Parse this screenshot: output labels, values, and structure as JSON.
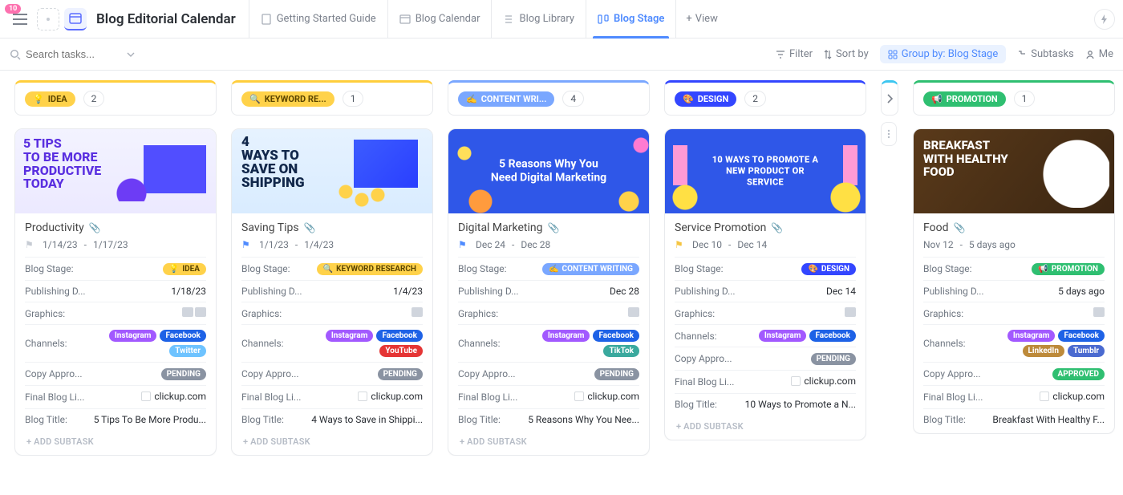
{
  "topbar": {
    "notification_count": "10",
    "project_title": "Blog Editorial Calendar",
    "views": [
      {
        "label": "Getting Started Guide",
        "active": false
      },
      {
        "label": "Blog Calendar",
        "active": false
      },
      {
        "label": "Blog Library",
        "active": false
      },
      {
        "label": "Blog Stage",
        "active": true
      }
    ],
    "add_view_label": "View"
  },
  "toolbar": {
    "search_placeholder": "Search tasks...",
    "filter_label": "Filter",
    "sort_label": "Sort by",
    "group_prefix": "Group by:",
    "group_value": "Blog Stage",
    "subtasks_label": "Subtasks",
    "me_label": "Me"
  },
  "add_subtask_label": "+ ADD SUBTASK",
  "fields": {
    "blog_stage": "Blog Stage:",
    "publishing_date": "Publishing D...",
    "graphics": "Graphics:",
    "channels": "Channels:",
    "copy_approval": "Copy Appro...",
    "final_link": "Final Blog Li...",
    "blog_title": "Blog Title:"
  },
  "columns": [
    {
      "id": "idea",
      "accent": "#ffce3d",
      "chip_label": "IDEA",
      "chip_class": "bg-idea",
      "chip_icon": "💡",
      "count": "2"
    },
    {
      "id": "keyword",
      "accent": "#ffce3d",
      "chip_label": "KEYWORD RE...",
      "chip_class": "bg-keyword",
      "chip_icon": "🔍",
      "count": "1"
    },
    {
      "id": "content",
      "accent": "#7aa7ff",
      "chip_label": "CONTENT WRI...",
      "chip_class": "bg-content",
      "chip_icon": "✍️",
      "count": "4"
    },
    {
      "id": "design",
      "accent": "#3346ff",
      "chip_label": "DESIGN",
      "chip_class": "bg-design",
      "chip_icon": "🎨",
      "count": "2"
    },
    {
      "id": "promo",
      "accent": "#2fbf71",
      "chip_label": "PROMOTION",
      "chip_class": "bg-promo",
      "chip_icon": "📢",
      "count": "1"
    }
  ],
  "cards": {
    "idea": {
      "title": "Productivity",
      "date_start": "1/14/23",
      "date_end": "1/17/23",
      "flag": "flag-grey",
      "stage_label": "IDEA",
      "stage_icon": "💡",
      "stage_class": "bg-idea",
      "publishing_date": "1/18/23",
      "channels": [
        "Instagram",
        "Facebook",
        "Twitter"
      ],
      "channel_classes": [
        "c-instagram",
        "c-facebook",
        "c-twitter"
      ],
      "copy_approval": "PENDING",
      "copy_class": "c-pending",
      "final_link": "clickup.com",
      "blog_title": "5 Tips To Be More Produ..."
    },
    "keyword": {
      "title": "Saving Tips",
      "date_start": "1/1/23",
      "date_end": "1/4/23",
      "flag": "flag-blue",
      "stage_label": "KEYWORD RESEARCH",
      "stage_icon": "🔍",
      "stage_class": "bg-keyword",
      "publishing_date": "1/4/23",
      "channels": [
        "Instagram",
        "Facebook",
        "YouTube"
      ],
      "channel_classes": [
        "c-instagram",
        "c-facebook",
        "c-youtube"
      ],
      "copy_approval": "PENDING",
      "copy_class": "c-pending",
      "final_link": "clickup.com",
      "blog_title": "4 Ways to Save in Shippi..."
    },
    "content": {
      "title": "Digital Marketing",
      "date_start": "Dec 24",
      "date_end": "Dec 28",
      "flag": "flag-blue",
      "stage_label": "CONTENT WRITING",
      "stage_icon": "✍️",
      "stage_class": "bg-content",
      "publishing_date": "Dec 28",
      "channels": [
        "Instagram",
        "Facebook",
        "TikTok"
      ],
      "channel_classes": [
        "c-instagram",
        "c-facebook",
        "c-tiktok"
      ],
      "copy_approval": "PENDING",
      "copy_class": "c-pending",
      "final_link": "clickup.com",
      "blog_title": "5 Reasons Why You Nee..."
    },
    "design": {
      "title": "Service Promotion",
      "date_start": "Dec 10",
      "date_end": "Dec 14",
      "flag": "flag-yellow",
      "stage_label": "DESIGN",
      "stage_icon": "🎨",
      "stage_class": "bg-design",
      "publishing_date": "Dec 14",
      "channels": [
        "Instagram",
        "Facebook"
      ],
      "channel_classes": [
        "c-instagram",
        "c-facebook"
      ],
      "copy_approval": "PENDING",
      "copy_class": "c-pending",
      "final_link": "clickup.com",
      "blog_title": "10 Ways to Promote a N..."
    },
    "promo": {
      "title": "Food",
      "date_start": "Nov 12",
      "date_end": "5 days ago",
      "flag": "",
      "stage_label": "PROMOTION",
      "stage_icon": "📢",
      "stage_class": "bg-promo",
      "publishing_date": "5 days ago",
      "channels": [
        "Instagram",
        "Facebook",
        "LinkedIn",
        "Tumblr"
      ],
      "channel_classes": [
        "c-instagram",
        "c-facebook",
        "c-linkedin",
        "c-tumblr"
      ],
      "copy_approval": "APPROVED",
      "copy_class": "c-approved",
      "final_link": "clickup.com",
      "blog_title": "Breakfast With Healthy F..."
    }
  }
}
